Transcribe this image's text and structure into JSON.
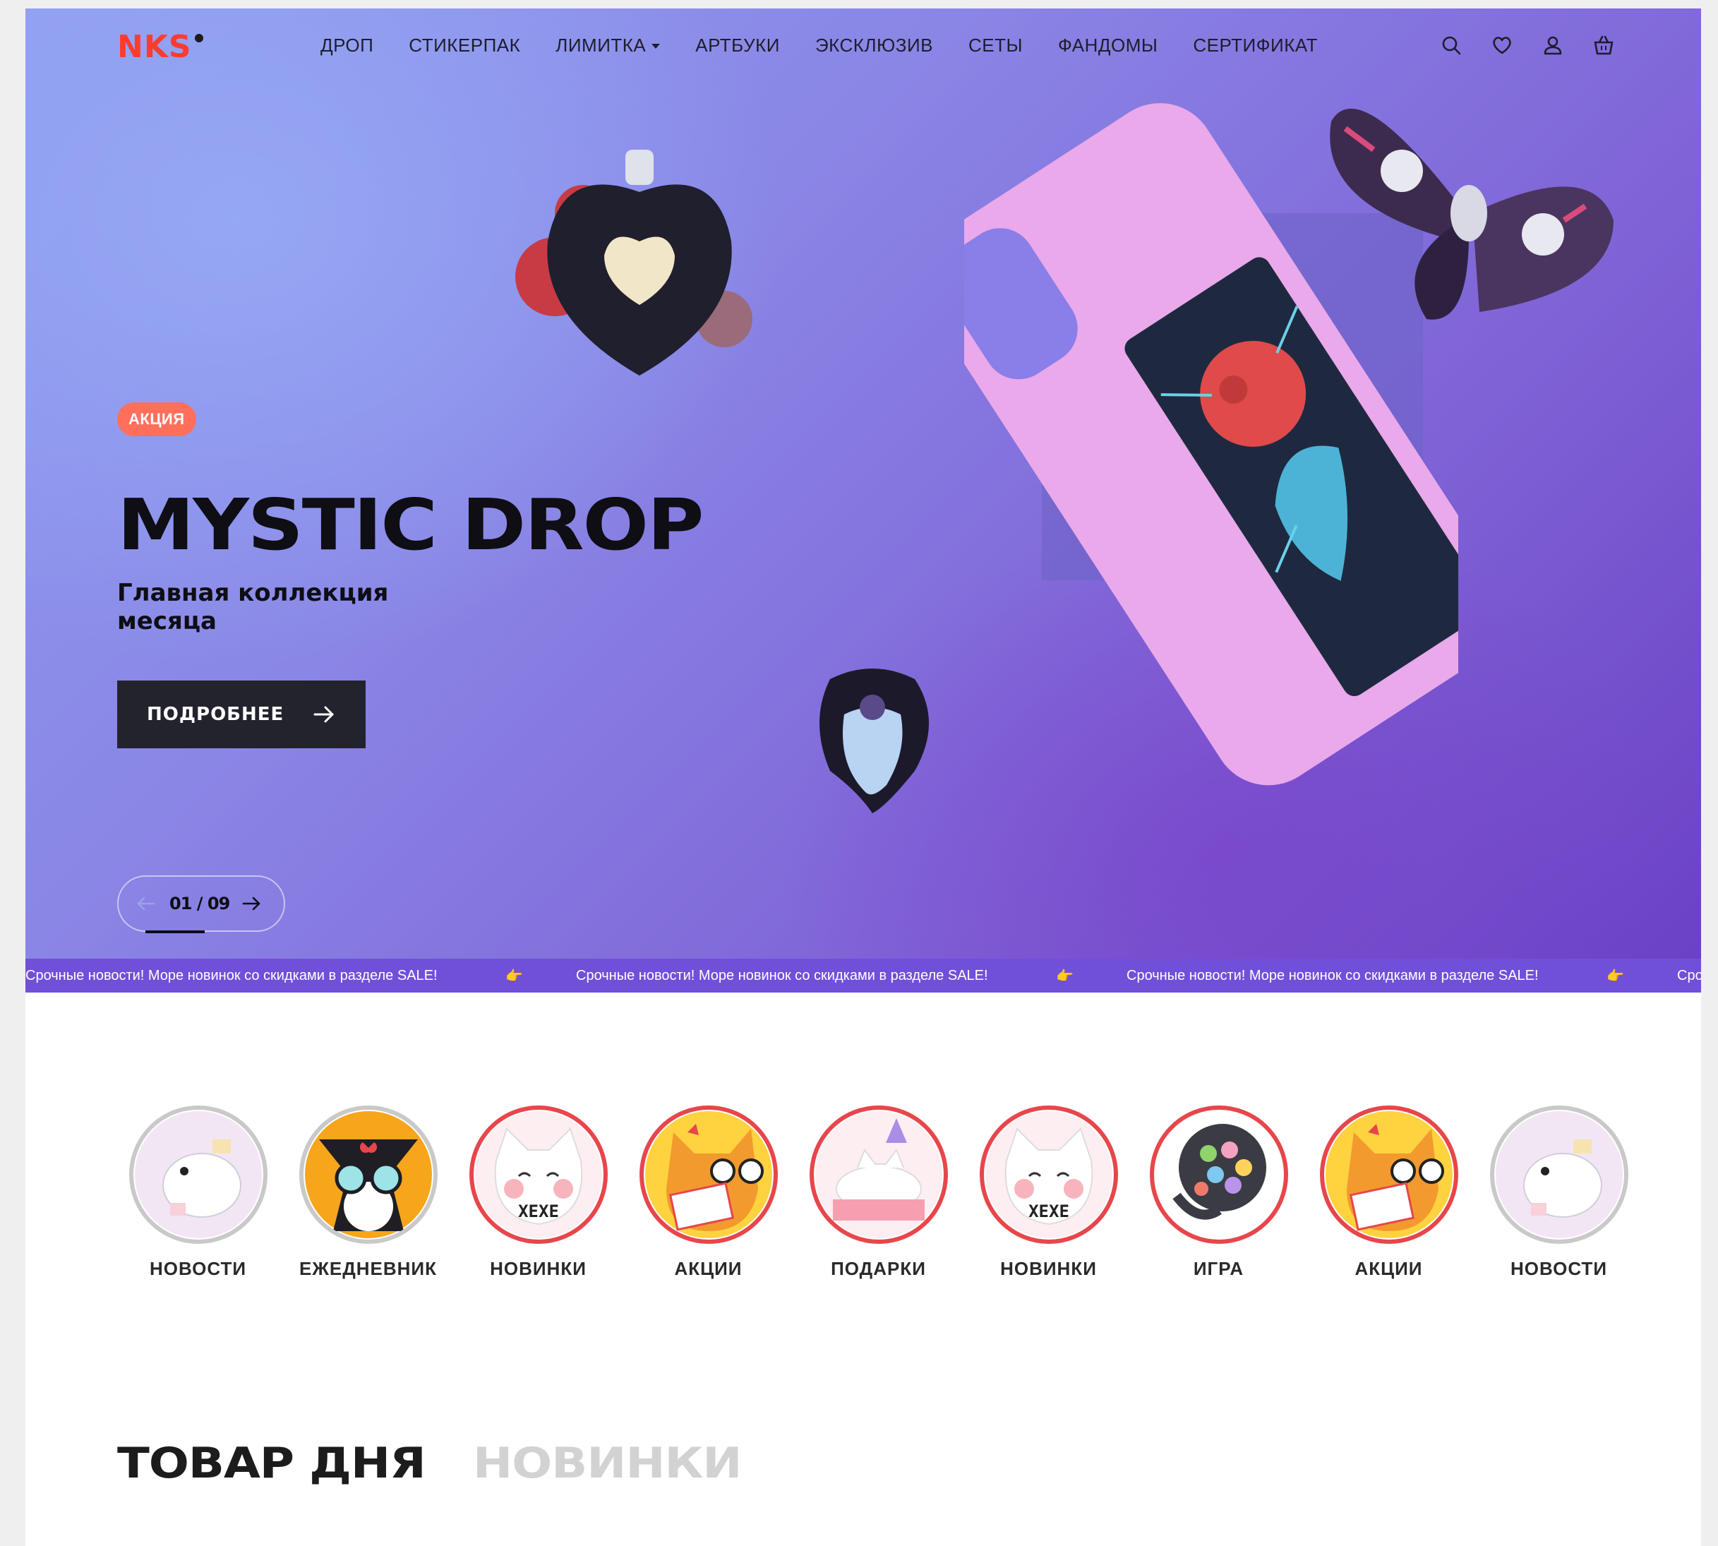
{
  "header": {
    "logo": "NKS",
    "menu": [
      {
        "label": "ДРОП"
      },
      {
        "label": "СТИКЕРПАК"
      },
      {
        "label": "ЛИМИТКА",
        "has_dropdown": true
      },
      {
        "label": "АРТБУКИ"
      },
      {
        "label": "ЭКСКЛЮЗИВ"
      },
      {
        "label": "СЕТЫ"
      },
      {
        "label": "ФАНДОМЫ"
      },
      {
        "label": "СЕРТИФИКАТ"
      }
    ],
    "icons": [
      "search-icon",
      "heart-icon",
      "user-icon",
      "cart-icon"
    ]
  },
  "hero": {
    "badge": "АКЦИЯ",
    "title": "MYSTIC DROP",
    "subtitle": "Главная коллекция месяца",
    "cta_label": "ПОДРОБНЕЕ",
    "slide_counter": "01 / 09",
    "colors": {
      "accent": "#ff3b30",
      "badge": "#ff6f5c",
      "cta": "#23232d"
    }
  },
  "ticker": {
    "text": "Срочные новости! Море новинок со скидками в разделе SALE!",
    "tail": "Срочны"
  },
  "categories": [
    {
      "label": "НОВОСТИ",
      "seen": true
    },
    {
      "label": "ЕЖЕДНЕВНИК",
      "seen": true
    },
    {
      "label": "НОВИНКИ",
      "seen": false
    },
    {
      "label": "АКЦИИ",
      "seen": false
    },
    {
      "label": "ПОДАРКИ",
      "seen": false
    },
    {
      "label": "НОВИНКИ",
      "seen": false
    },
    {
      "label": "ИГРА",
      "seen": false
    },
    {
      "label": "АКЦИИ",
      "seen": false
    },
    {
      "label": "НОВОСТИ",
      "seen": true
    }
  ],
  "sticker_text": {
    "xexe": "XEXE"
  },
  "sections": {
    "tab_active": "ТОВАР ДНЯ",
    "tab_inactive": "НОВИНКИ"
  }
}
